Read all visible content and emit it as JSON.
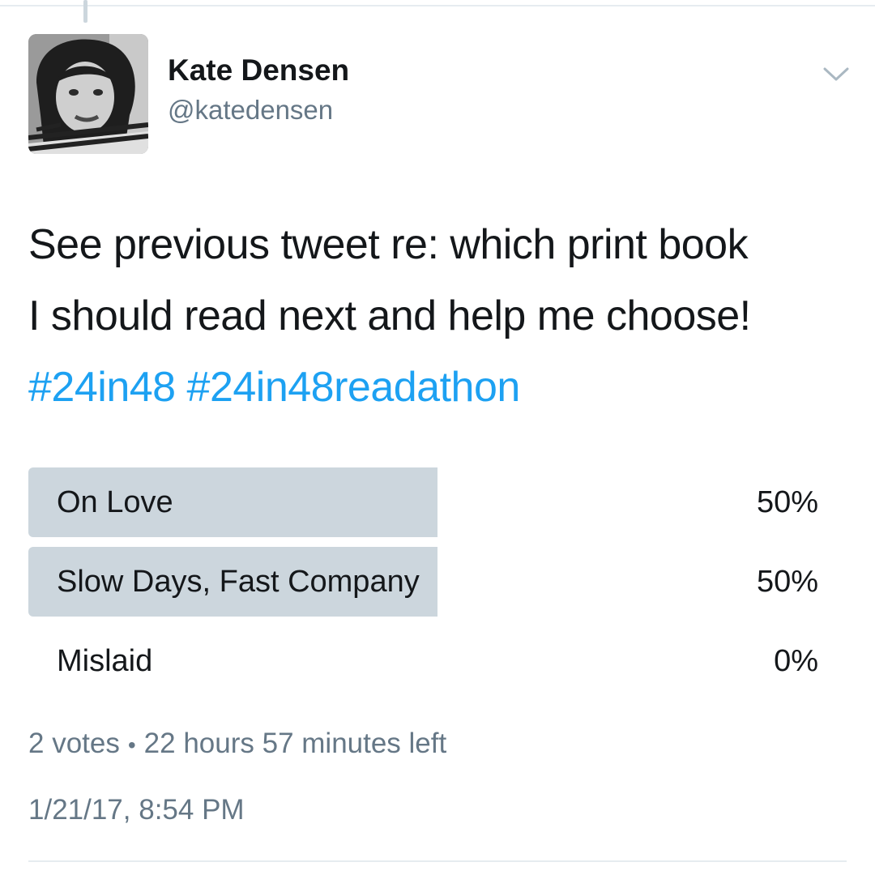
{
  "tweet": {
    "author": {
      "display_name": "Kate Densen",
      "handle": "@katedensen",
      "avatar_icon": "profile-photo"
    },
    "text_lines": [
      "See previous tweet re: which print book",
      "I should read next and help me choose!"
    ],
    "hashtags": [
      "#24in48",
      "#24in48readathon"
    ],
    "menu_icon": "chevron-down-icon",
    "timestamp": "1/21/17, 8:54 PM"
  },
  "poll": {
    "options": [
      {
        "label": "On Love",
        "percent_text": "50%",
        "percent": 50
      },
      {
        "label": "Slow Days, Fast Company",
        "percent_text": "50%",
        "percent": 50
      },
      {
        "label": "Mislaid",
        "percent_text": "0%",
        "percent": 0
      }
    ],
    "votes": "2 votes",
    "separator": "•",
    "time_left": "22 hours 57 minutes left"
  },
  "colors": {
    "text": "#14171a",
    "secondary": "#657786",
    "hashtag": "#1da1f2",
    "poll_bar": "#ccd6dd",
    "divider": "#e6ecf0"
  }
}
